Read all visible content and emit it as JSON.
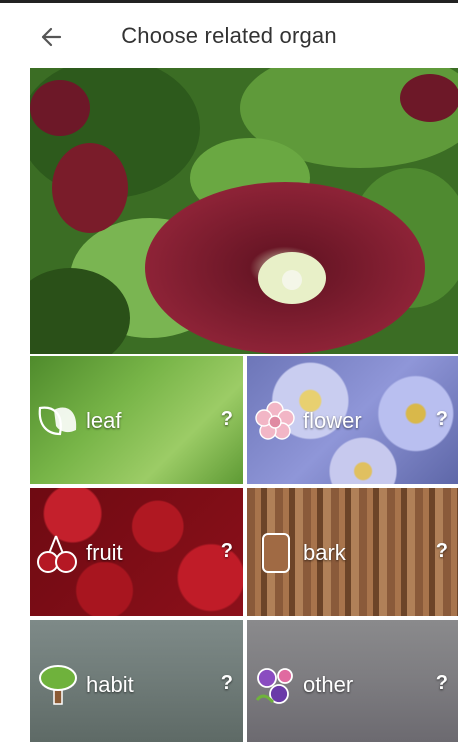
{
  "header": {
    "title": "Choose related organ",
    "back_icon": "arrow-left-icon"
  },
  "organs": [
    {
      "id": "leaf",
      "label": "leaf",
      "help": "?",
      "icon": "leaf-icon"
    },
    {
      "id": "flower",
      "label": "flower",
      "help": "?",
      "icon": "flower-icon"
    },
    {
      "id": "fruit",
      "label": "fruit",
      "help": "?",
      "icon": "cherries-icon"
    },
    {
      "id": "bark",
      "label": "bark",
      "help": "?",
      "icon": "bark-icon"
    },
    {
      "id": "habit",
      "label": "habit",
      "help": "?",
      "icon": "tree-icon"
    },
    {
      "id": "other",
      "label": "other",
      "help": "?",
      "icon": "flowers-icon"
    }
  ],
  "colors": {
    "header_text": "#333333",
    "tile_text": "#ffffff"
  }
}
